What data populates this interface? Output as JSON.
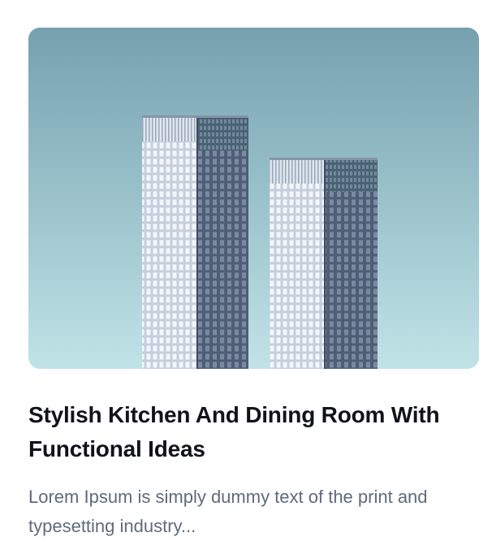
{
  "card": {
    "image_alt": "Two high-rise glass towers against a pale blue sky",
    "title": "Stylish Kitchen And Dining Room With Functional Ideas",
    "excerpt": "Lorem Ipsum is simply dummy text of the print and typesetting industry..."
  },
  "colors": {
    "sky_top": "#76a3b1",
    "sky_bottom": "#bfe2e6",
    "title_text": "#111319",
    "excerpt_text": "#5f6b7a"
  }
}
